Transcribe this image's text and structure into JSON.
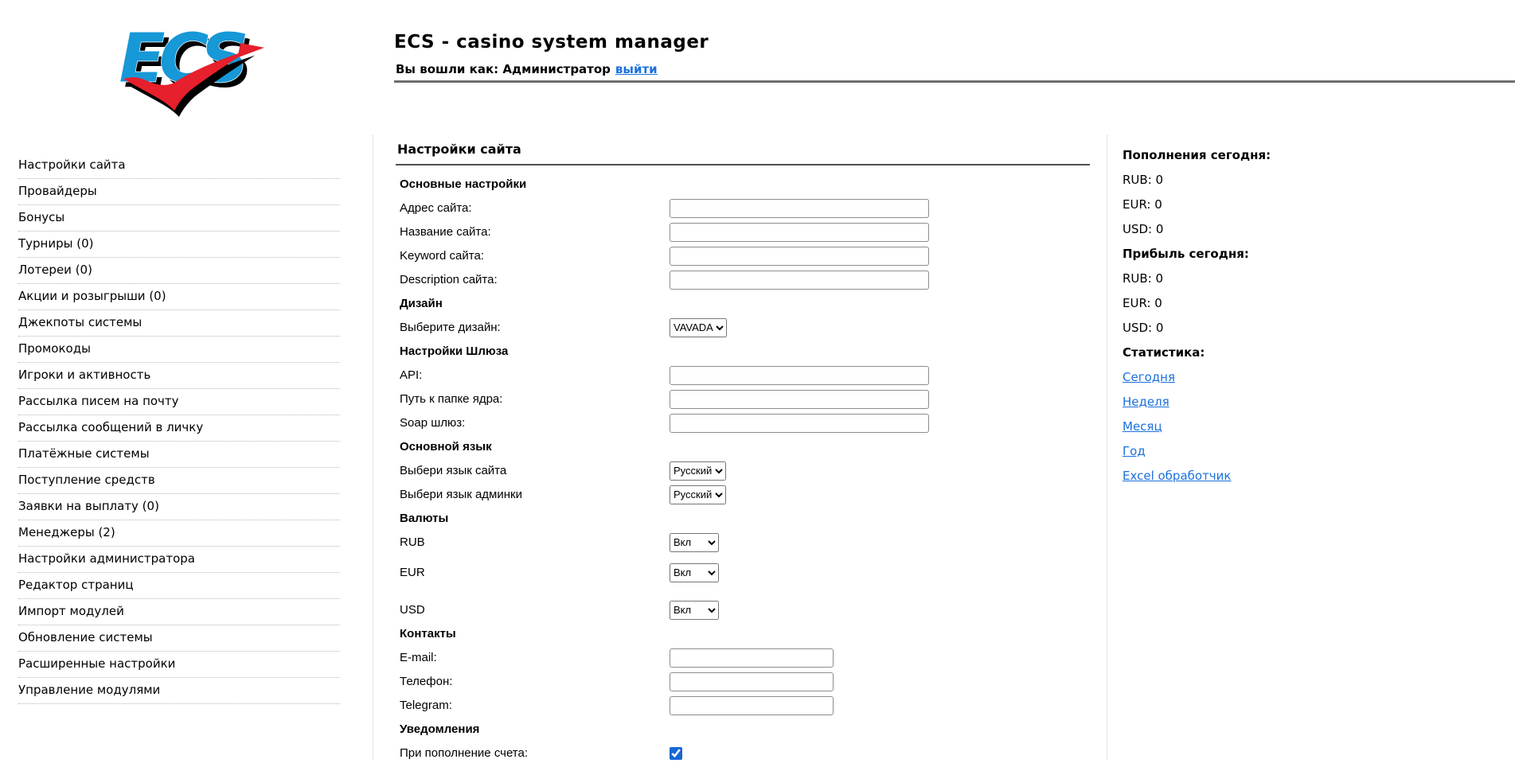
{
  "header": {
    "logo_text": "ECS",
    "title": "ECS - casino system manager",
    "login_text": "Вы вошли как: Администратор",
    "logout_label": "выйти"
  },
  "sidebar": {
    "items": [
      "Настройки сайта",
      "Провайдеры",
      "Бонусы",
      "Турниры (0)",
      "Лотереи (0)",
      "Акции и розыгрыши (0)",
      "Джекпоты системы",
      "Промокоды",
      "Игроки и активность",
      "Рассылка писем на почту",
      "Рассылка сообщений в личку",
      "Платёжные системы",
      "Поступление средств",
      "Заявки на выплату (0)",
      "Менеджеры (2)",
      "Настройки администратора",
      "Редактор страниц",
      "Импорт модулей",
      "Обновление системы",
      "Расширенные настройки",
      "Управление модулями"
    ]
  },
  "main": {
    "title": "Настройки сайта",
    "form": {
      "rows": [
        {
          "type": "section",
          "label": "Основные настройки"
        },
        {
          "type": "text",
          "label": "Адрес сайта:",
          "value": "",
          "placeholder": "",
          "size": "wide",
          "name": "site-address-input"
        },
        {
          "type": "text",
          "label": "Название сайта:",
          "value": "",
          "placeholder": "",
          "size": "wide",
          "name": "site-name-input"
        },
        {
          "type": "text",
          "label": "Keyword сайта:",
          "value": "",
          "placeholder": "",
          "size": "wide",
          "name": "site-keyword-input"
        },
        {
          "type": "text",
          "label": "Description сайта:",
          "value": "",
          "placeholder": "",
          "size": "wide",
          "name": "site-description-input"
        },
        {
          "type": "section",
          "label": "Дизайн"
        },
        {
          "type": "select",
          "label": "Выберите дизайн:",
          "value": "VAVADA",
          "name": "design-select"
        },
        {
          "type": "section",
          "label": "Настройки Шлюза"
        },
        {
          "type": "text",
          "label": "API:",
          "value": "",
          "placeholder": "",
          "size": "wide",
          "name": "api-input"
        },
        {
          "type": "text",
          "label": "Путь к папке ядра:",
          "value": "",
          "placeholder": "",
          "size": "wide",
          "name": "core-folder-path-input"
        },
        {
          "type": "text",
          "label": "Soap шлюз:",
          "value": "",
          "placeholder": "",
          "size": "wide",
          "name": "soap-gateway-input"
        },
        {
          "type": "section",
          "label": "Основной язык"
        },
        {
          "type": "select",
          "label": "Выбери язык сайта",
          "value": "Русский",
          "name": "site-language-select"
        },
        {
          "type": "select",
          "label": "Выбери язык админки",
          "value": "Русский",
          "name": "admin-language-select"
        },
        {
          "type": "section",
          "label": "Валюты"
        },
        {
          "type": "select",
          "label": "RUB",
          "value": "Вкл",
          "name": "currency-rub-select",
          "spacing": "wide"
        },
        {
          "type": "select",
          "label": "EUR",
          "value": "Вкл",
          "name": "currency-eur-select",
          "spacing": "wider"
        },
        {
          "type": "select",
          "label": "USD",
          "value": "Вкл",
          "name": "currency-usd-select"
        },
        {
          "type": "section",
          "label": "Контакты"
        },
        {
          "type": "text",
          "label": "E-mail:",
          "value": "",
          "placeholder": "",
          "size": "narrow",
          "name": "email-input"
        },
        {
          "type": "text",
          "label": "Телефон:",
          "value": "",
          "placeholder": "",
          "size": "narrow",
          "name": "phone-input"
        },
        {
          "type": "text",
          "label": "Telegram:",
          "value": "",
          "placeholder": "",
          "size": "narrow",
          "name": "telegram-input"
        },
        {
          "type": "section",
          "label": "Уведомления"
        },
        {
          "type": "checkbox",
          "label": "При пополнение счета:",
          "checked": true,
          "name": "notify-on-deposit-checkbox"
        }
      ]
    }
  },
  "stats": {
    "rows": [
      {
        "type": "header",
        "text": "Пополнения сегодня:"
      },
      {
        "type": "value",
        "text": "RUB: 0"
      },
      {
        "type": "value",
        "text": "EUR: 0"
      },
      {
        "type": "value",
        "text": "USD: 0"
      },
      {
        "type": "header",
        "text": "Прибыль сегодня:"
      },
      {
        "type": "value",
        "text": "RUB: 0"
      },
      {
        "type": "value",
        "text": "EUR: 0"
      },
      {
        "type": "value",
        "text": "USD: 0"
      },
      {
        "type": "header",
        "text": "Статистика:"
      },
      {
        "type": "link",
        "text": "Сегодня",
        "name": "stats-today-link"
      },
      {
        "type": "link",
        "text": "Неделя",
        "name": "stats-week-link"
      },
      {
        "type": "link",
        "text": "Месяц",
        "name": "stats-month-link"
      },
      {
        "type": "link",
        "text": "Год",
        "name": "stats-year-link"
      },
      {
        "type": "link",
        "text": "Excel обработчик",
        "name": "stats-excel-link"
      }
    ]
  },
  "colors": {
    "link_blue": "#1a70dc",
    "logo_blue": "#1798d7",
    "logo_red": "#e6202c",
    "checkbox_blue": "#1567d3"
  }
}
